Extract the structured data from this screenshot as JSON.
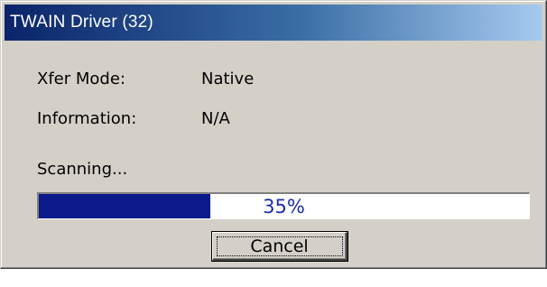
{
  "window": {
    "title": "TWAIN Driver (32)"
  },
  "fields": {
    "xfer_mode_label": "Xfer Mode:",
    "xfer_mode_value": "Native",
    "information_label": "Information:",
    "information_value": "N/A"
  },
  "status": {
    "text": "Scanning..."
  },
  "progress": {
    "percent": 35,
    "label": "35%"
  },
  "buttons": {
    "cancel_label": "Cancel"
  },
  "colors": {
    "titlebar_start": "#0a246a",
    "titlebar_end": "#a6caf0",
    "progress_fill": "#0a1a8a",
    "progress_text": "#1a2ea8",
    "dialog_face": "#d4d0c8"
  }
}
